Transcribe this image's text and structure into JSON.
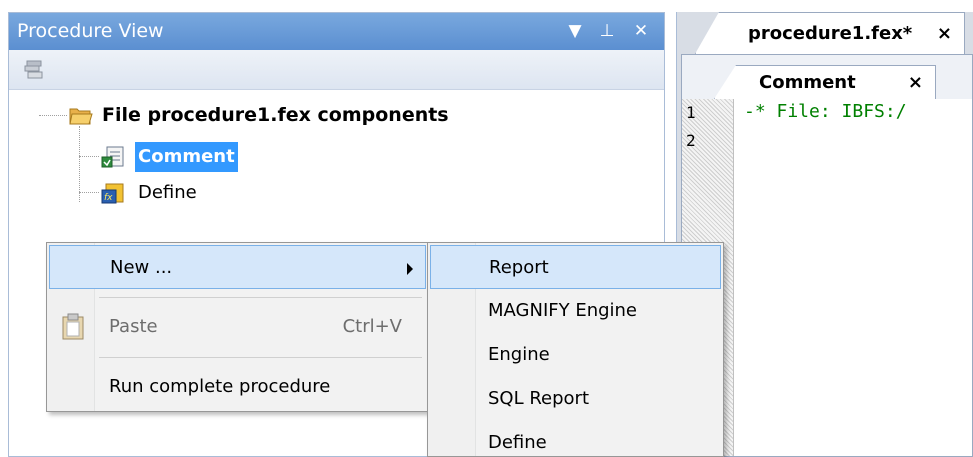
{
  "procedure_view": {
    "title": "Procedure View",
    "title_buttons": [
      "▼",
      "⊥",
      "✕"
    ],
    "icons": {
      "toolbar": "stack-icon",
      "folder": "folder-icon",
      "comment": "comment-icon",
      "define": "define-fx-icon"
    },
    "tree": {
      "root": "File procedure1.fex components",
      "children": [
        "Comment",
        "Define"
      ],
      "selected": "Comment"
    }
  },
  "editor": {
    "file_tab": {
      "label": "procedure1.fex*",
      "close": "×"
    },
    "component_tab": {
      "label": "Comment",
      "close": "×"
    },
    "lines": [
      {
        "num": "1",
        "text": "-* File: IBFS:/"
      },
      {
        "num": "2",
        "text": ""
      }
    ],
    "code_color": "#008000"
  },
  "context_menu": {
    "items": [
      {
        "label": "New ...",
        "shortcut": "",
        "highlight": true,
        "submenu": true
      },
      {
        "label": "Paste",
        "shortcut": "Ctrl+V",
        "disabled": true,
        "icon": "clipboard-icon"
      },
      {
        "label": "Run complete procedure",
        "shortcut": ""
      }
    ]
  },
  "submenu": {
    "items": [
      "Report",
      "MAGNIFY Engine",
      "Engine",
      "SQL Report",
      "Define"
    ],
    "highlighted": "Report"
  },
  "colors": {
    "title_bar": "#5b8fd1",
    "selection": "#3399ff",
    "menu_highlight": "#d5e7fa"
  }
}
